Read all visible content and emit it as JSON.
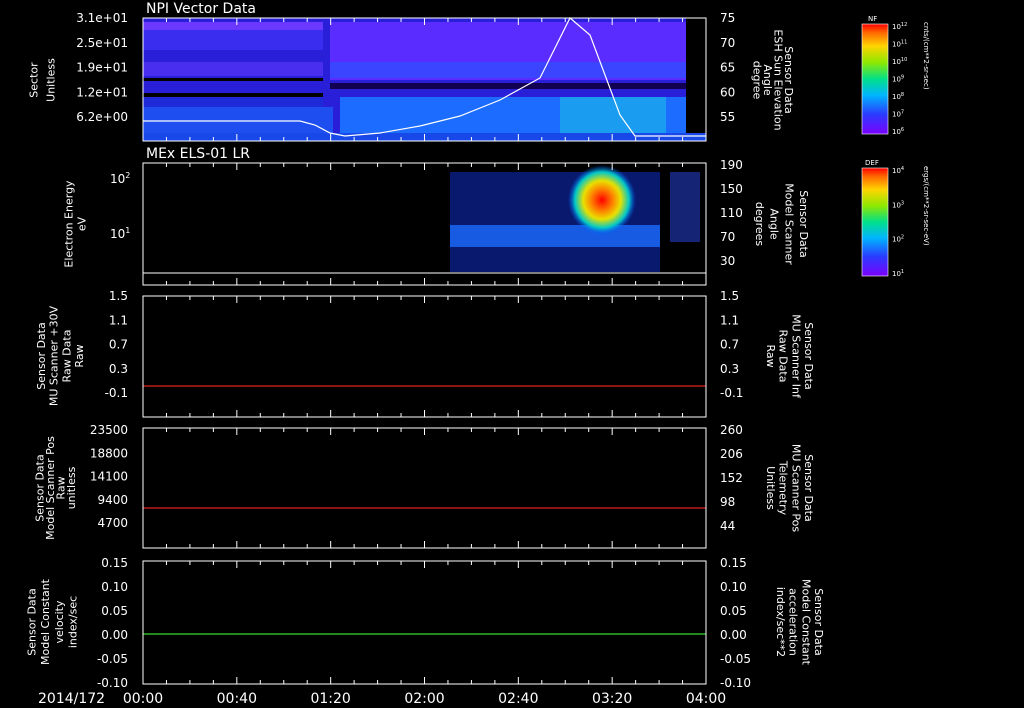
{
  "chart_data": [
    {
      "type": "heatmap",
      "title": "NPI Vector Data",
      "ylabel": "Sector\nUnitless",
      "yticks": [
        "3.1e+01",
        "2.5e+01",
        "1.9e+01",
        "1.2e+01",
        "6.2e+00"
      ],
      "y2label": "Sensor Data\nESH Sun Elevation\nAngle\ndegree",
      "y2ticks": [
        "75",
        "70",
        "65",
        "60",
        "55"
      ],
      "y2lim": [
        50,
        75
      ],
      "line_series": {
        "x": [
          "00:00",
          "00:40",
          "01:05",
          "01:20",
          "01:40",
          "02:00",
          "02:20",
          "02:40",
          "03:00",
          "03:05",
          "03:10",
          "03:20",
          "03:30",
          "04:00"
        ],
        "values": [
          52,
          52,
          52,
          50.5,
          51.5,
          53.5,
          56,
          59.5,
          65,
          75,
          75,
          64,
          52,
          52
        ]
      },
      "colorbar": {
        "label": "NF",
        "units": "cnts/(cm**2-sr-sec)",
        "ticks": [
          "10^12",
          "10^11",
          "10^10",
          "10^9",
          "10^8",
          "10^7",
          "10^6"
        ]
      }
    },
    {
      "type": "heatmap",
      "title": "MEx ELS-01 LR",
      "ylabel": "Electron Energy\neV",
      "yticks": [
        "10^2",
        "10^1"
      ],
      "y2label": "Sensor Data\nModel Scanner\nAngle\ndegrees",
      "y2ticks": [
        "190",
        "150",
        "110",
        "70",
        "30"
      ],
      "y2lim": [
        0,
        190
      ],
      "line_series": {
        "x": [
          "00:00",
          "04:00"
        ],
        "values": [
          6,
          6
        ]
      },
      "colorbar": {
        "label": "DEF",
        "units": "ergs/(cm**2-sr-sec-eV)",
        "ticks": [
          "10^4",
          "10^3",
          "10^2",
          "10^1"
        ]
      }
    },
    {
      "type": "line",
      "ylabel": "Sensor Data\nMU Scanner +30V\nRaw Data\nRaw",
      "yticks": [
        "1.5",
        "1.1",
        "0.7",
        "0.3",
        "-0.1"
      ],
      "ylim": [
        -0.3,
        1.5
      ],
      "y2label": "Sensor Data\nMU Scanner Inf\nRaw Data\nRaw",
      "series": [
        {
          "color": "#dd2222",
          "values": [
            0.0,
            0.0
          ]
        }
      ]
    },
    {
      "type": "line",
      "ylabel": "Sensor Data\nModel Scanner Pos\nRaw\nunitless",
      "yticks": [
        "23500",
        "18800",
        "14100",
        "9400",
        "4700"
      ],
      "ylim": [
        0,
        23500
      ],
      "y2label": "Sensor Data\nMU Scanner Pos\nTelemetry\nUnitless",
      "y2ticks": [
        "260",
        "206",
        "152",
        "98",
        "44"
      ],
      "y2lim": [
        -10,
        260
      ],
      "series": [
        {
          "color": "#dd2222",
          "values": [
            7400,
            7400
          ]
        }
      ]
    },
    {
      "type": "line",
      "ylabel": "Sensor Data\nModel Constant\nvelocity\nindex/sec",
      "yticks": [
        "0.15",
        "0.10",
        "0.05",
        "0.00",
        "-0.05",
        "-0.10"
      ],
      "ylim": [
        -0.1,
        0.15
      ],
      "y2label": "Sensor Data\nModel Constant\nacceleration\nindex/sec**2",
      "series": [
        {
          "color": "#33dd33",
          "values": [
            0.0,
            0.0
          ]
        }
      ]
    }
  ],
  "xaxis": {
    "date": "2014/172",
    "ticks": [
      "00:00",
      "00:40",
      "01:20",
      "02:00",
      "02:40",
      "03:20",
      "04:00"
    ]
  },
  "colors": {
    "red_label": "#ff2a2a",
    "green_label": "#22ee22",
    "axis": "#ffffff"
  }
}
